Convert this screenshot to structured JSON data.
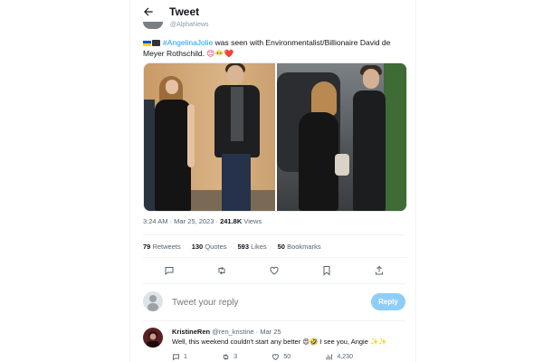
{
  "header": {
    "title": "Tweet",
    "handle_peek": "@AlphaNews"
  },
  "tweet": {
    "hashtag": "#AngelinaJolie",
    "text": "was seen with Environmentalist/Billionaire David de Meyer Rothschild.",
    "emojis": "😊😶‍🌫️❤️",
    "time": "3:24 AM · Mar 25, 2023 ·",
    "views": "241.8K",
    "views_label": "Views",
    "stats": {
      "retweets_count": "79",
      "retweets_label": "Retweets",
      "quotes_count": "130",
      "quotes_label": "Quotes",
      "likes_count": "593",
      "likes_label": "Likes",
      "bookmarks_count": "50",
      "bookmarks_label": "Bookmarks"
    }
  },
  "reply": {
    "placeholder": "Tweet your reply",
    "button_label": "Reply"
  },
  "comment": {
    "name": "KristineRen",
    "handle": "@ren_kristine",
    "date": "· Mar 25",
    "text": "Well, this weekend couldn't start any better 😍🤣 I see you, Angie ✨✨",
    "replies": "1",
    "retweets": "3",
    "likes": "50",
    "views": "4,230"
  },
  "colors": {
    "accent": "#1d9bf0",
    "reply_button": "#8ecdf8",
    "text_secondary": "#536471"
  }
}
